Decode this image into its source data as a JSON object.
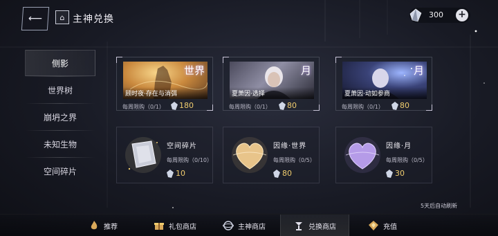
{
  "header": {
    "back_icon": "arrow-left-icon",
    "home_icon": "home-icon",
    "title": "主神兑换",
    "currency": {
      "icon": "crystal-icon",
      "value": "300",
      "add_label": "+"
    }
  },
  "sidebar": {
    "items": [
      {
        "label": "侧影",
        "active": true
      },
      {
        "label": "世界树",
        "active": false
      },
      {
        "label": "崩坍之界",
        "active": false
      },
      {
        "label": "未知生物",
        "active": false
      },
      {
        "label": "空间碎片",
        "active": false
      }
    ]
  },
  "shop": {
    "featured": [
      {
        "name": "顾时夜·存在与消弭",
        "tag": "世界",
        "limit": "每周限购（0/1）",
        "price": "180",
        "art": "golden-figure"
      },
      {
        "name": "夏萧因·选择",
        "tag": "月",
        "limit": "每周限购（0/1）",
        "price": "80",
        "art": "white-hair-portrait"
      },
      {
        "name": "夏萧因·动如参商",
        "tag": "月",
        "limit": "每周限购（0/1）",
        "price": "80",
        "art": "night-portrait"
      }
    ],
    "items": [
      {
        "name": "空间碎片",
        "limit": "每周限购（0/10）",
        "price": "10",
        "icon": "crystal-shard-icon"
      },
      {
        "name": "因缘·世界",
        "limit": "每周限购（0/5）",
        "price": "80",
        "icon": "gold-heart-icon"
      },
      {
        "name": "因缘·月",
        "limit": "每周限购（0/5）",
        "price": "30",
        "icon": "purple-heart-icon"
      }
    ],
    "refresh_note": "5天后自动刷新"
  },
  "bottom_nav": [
    {
      "label": "推荐",
      "icon": "flame-crest-icon",
      "active": false
    },
    {
      "label": "礼包商店",
      "icon": "gift-icon",
      "active": false
    },
    {
      "label": "主神商店",
      "icon": "globe-icon",
      "active": false
    },
    {
      "label": "兑换商店",
      "icon": "exchange-icon",
      "active": true
    },
    {
      "label": "充值",
      "icon": "diamond-crest-icon",
      "active": false
    }
  ],
  "colors": {
    "accent_gold": "#f0cc6e",
    "text": "#e8e6ef",
    "bg": "#181a24"
  }
}
